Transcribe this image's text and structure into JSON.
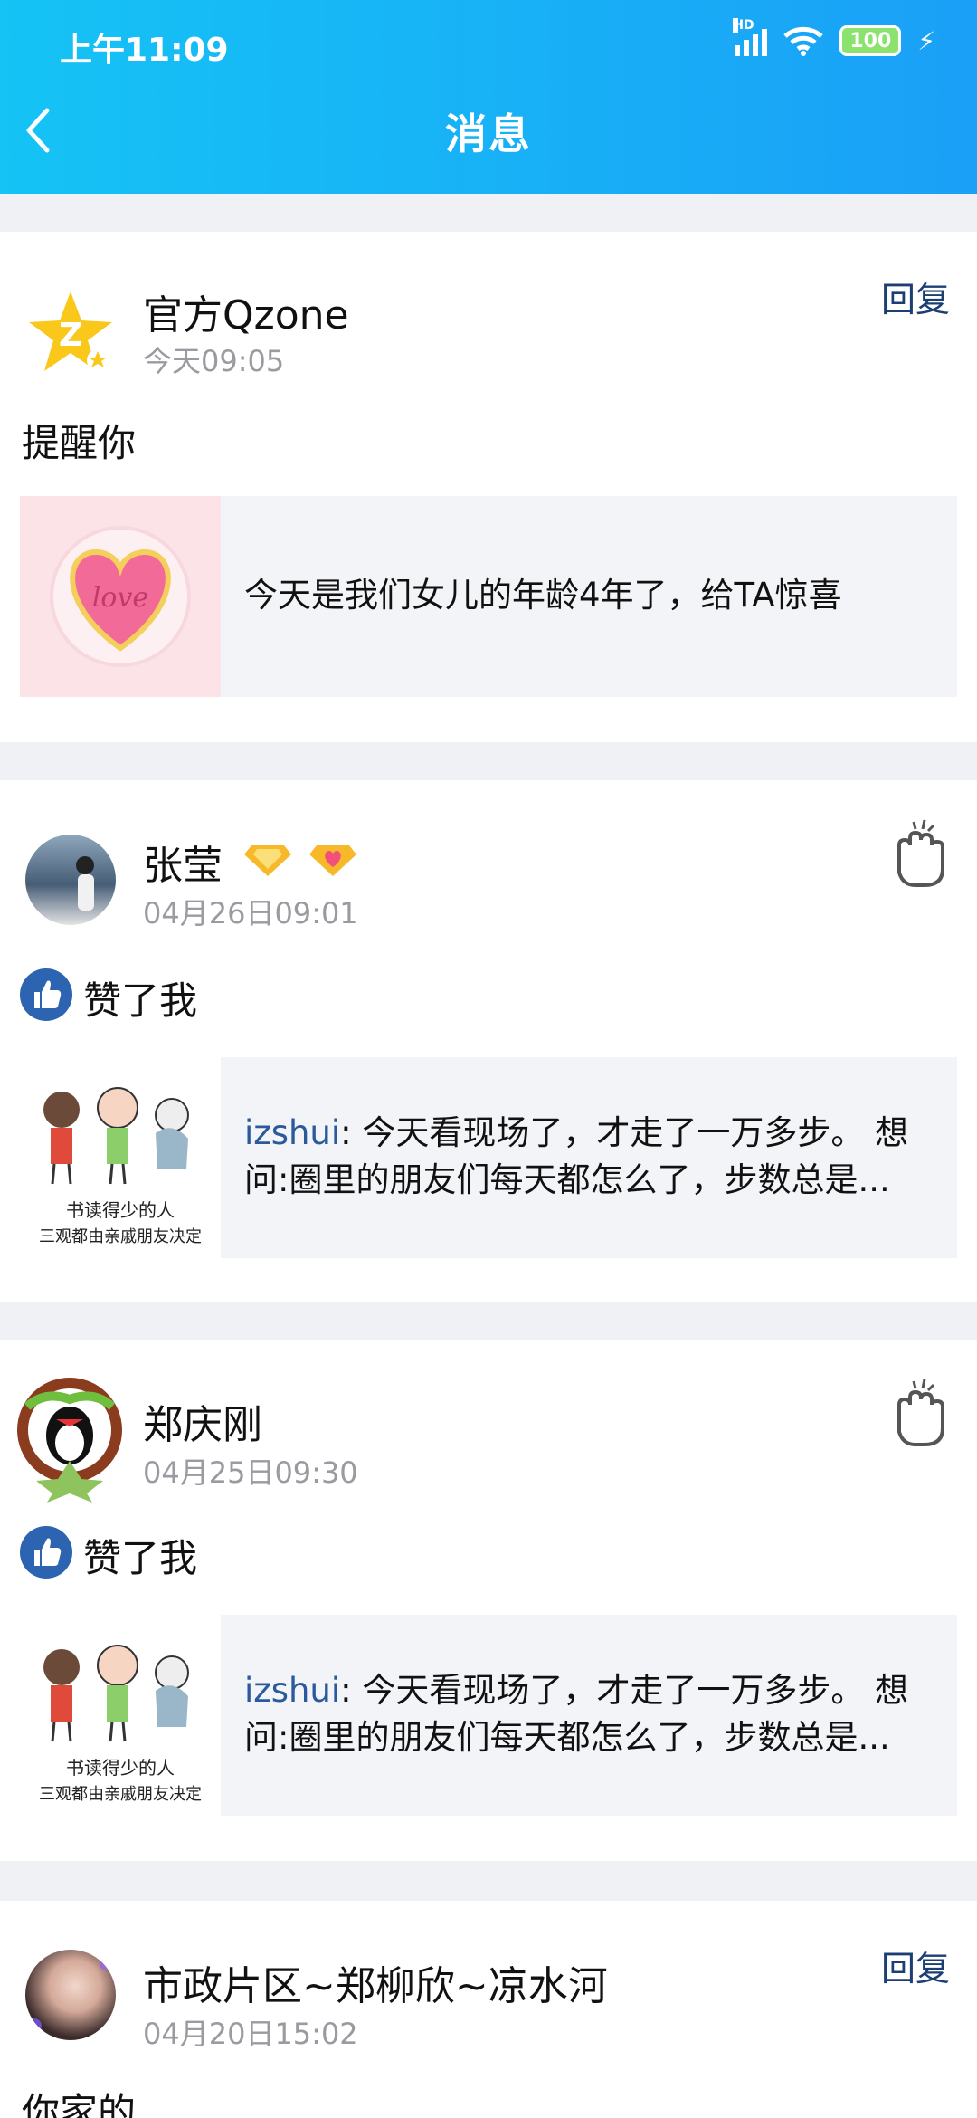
{
  "status_bar": {
    "time": "上午11:09",
    "network_label": "HD",
    "battery": "100"
  },
  "header": {
    "title": "消息",
    "back_icon": "chevron-left-icon"
  },
  "colors": {
    "header_start": "#15c3f5",
    "header_end": "#1aa0f7",
    "link_blue": "#2a5a9c",
    "reply_blue": "#1c3f73",
    "like_blue": "#2d64b2"
  },
  "messages": [
    {
      "sender": "官方Qzone",
      "time": "今天09:05",
      "action_label": "回复",
      "text": "提醒你",
      "quote": {
        "user": "",
        "content": "今天是我们女儿的年龄4年了，给TA惊喜",
        "thumb_text": "love"
      }
    },
    {
      "sender": "张莹",
      "time": "04月26日09:01",
      "action_icon": "wave-hand-icon",
      "text": "赞了我",
      "quote": {
        "user": "izshui",
        "content": ": 今天看现场了，才走了一万多步。 想问:圈里的朋友们每天都怎么了，步数总是...",
        "thumb_caption_1": "书读得少的人",
        "thumb_caption_2": "三观都由亲戚朋友决定"
      }
    },
    {
      "sender": "郑庆刚",
      "time": "04月25日09:30",
      "action_icon": "wave-hand-icon",
      "text": "赞了我",
      "quote": {
        "user": "izshui",
        "content": ": 今天看现场了，才走了一万多步。 想问:圈里的朋友们每天都怎么了，步数总是...",
        "thumb_caption_1": "书读得少的人",
        "thumb_caption_2": "三观都由亲戚朋友决定"
      }
    },
    {
      "sender": "市政片区~郑柳欣~凉水河",
      "time": "04月20日15:02",
      "action_label": "回复",
      "text": "你家的"
    }
  ]
}
